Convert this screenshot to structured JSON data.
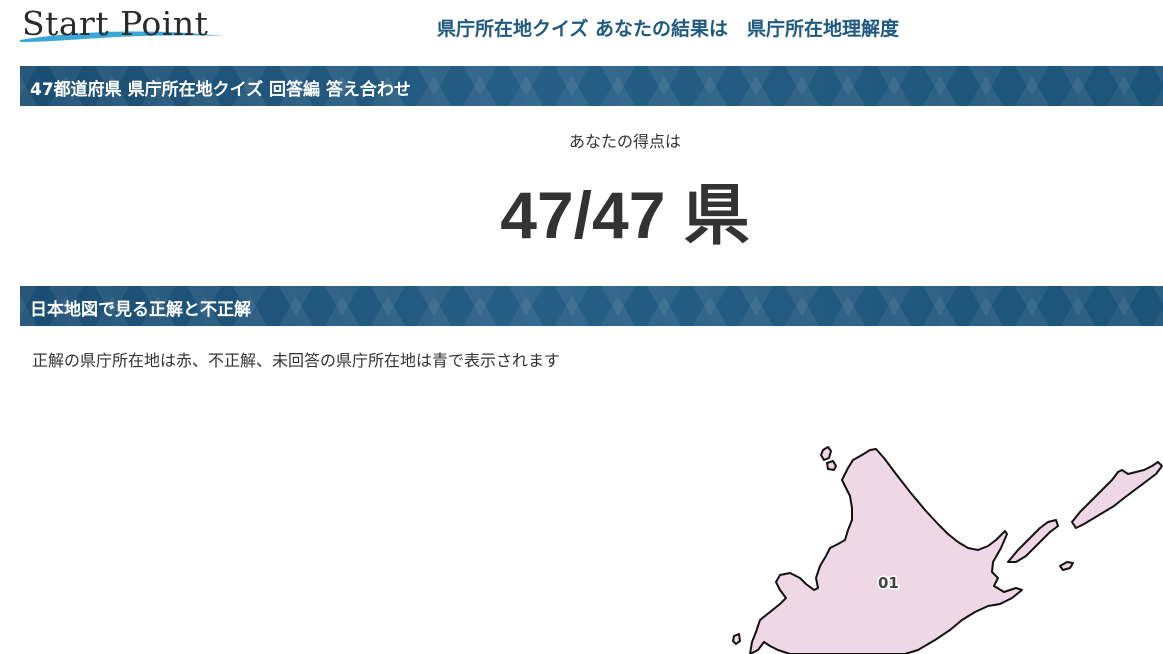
{
  "header": {
    "logo_text": "Start Point",
    "title": "県庁所在地クイズ あなたの結果は　県庁所在地理解度"
  },
  "section1": {
    "heading": "47都道府県 県庁所在地クイズ 回答編 答え合わせ"
  },
  "score": {
    "caption": "あなたの得点は",
    "value": "47/47 県"
  },
  "section2": {
    "heading": "日本地図で見る正解と不正解",
    "description": "正解の県庁所在地は赤、不正解、未回答の県庁所在地は青で表示されます"
  },
  "map": {
    "correct_fill": "#eed8e5",
    "outline_color": "#111111",
    "prefectures": [
      {
        "code": "01",
        "status": "correct"
      }
    ]
  }
}
